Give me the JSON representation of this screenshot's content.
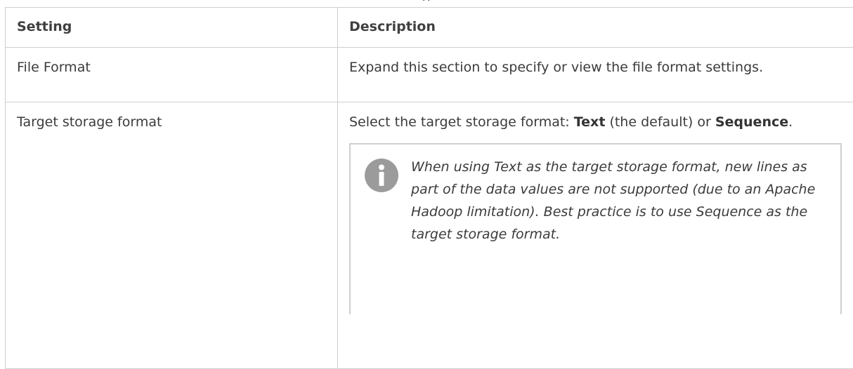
{
  "caption_fragment": "g",
  "table": {
    "headers": {
      "setting": "Setting",
      "description": "Description"
    },
    "rows": [
      {
        "setting": "File Format",
        "description": "Expand this section to specify or view the file format settings."
      },
      {
        "setting": "Target storage format",
        "description_parts": {
          "prefix": "Select the target storage format: ",
          "bold1": "Text",
          "middle": " (the default) or ",
          "bold2": "Sequence",
          "suffix": "."
        },
        "note": {
          "icon": "info-icon",
          "text": "When using Text as the target storage format, new lines as part of the data values are not supported (due to an Apache Hadoop limitation). Best practice is to use Sequence as the target storage format."
        }
      }
    ]
  },
  "colors": {
    "border": "#cfcfcf",
    "icon": "#9b9b9b"
  }
}
